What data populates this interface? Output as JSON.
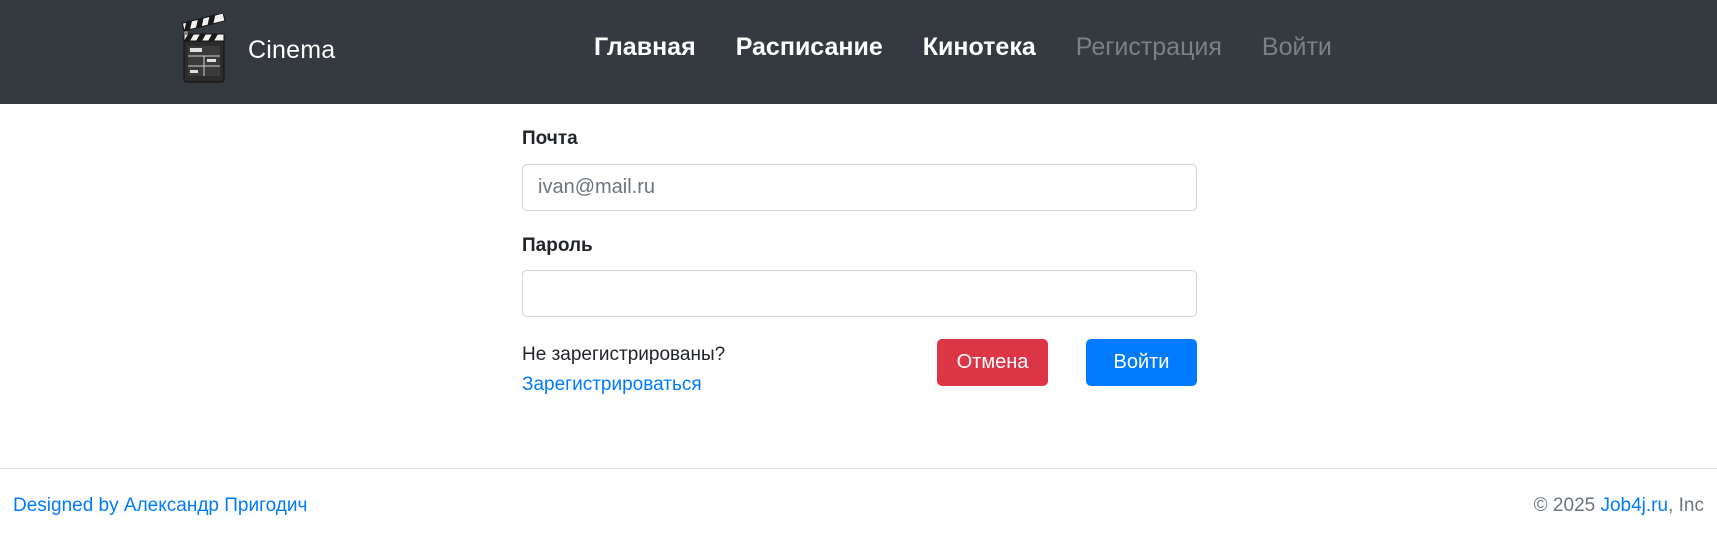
{
  "navbar": {
    "brand": {
      "logo_icon": "clapperboard-icon",
      "name": "Cinema"
    },
    "links": [
      {
        "label": "Главная",
        "state": "active"
      },
      {
        "label": "Расписание",
        "state": "active"
      },
      {
        "label": "Кинотека",
        "state": "active"
      },
      {
        "label": "Регистрация",
        "state": "muted"
      },
      {
        "label": "Войти",
        "state": "muted"
      }
    ]
  },
  "login_form": {
    "email_label": "Почта",
    "email_placeholder": "ivan@mail.ru",
    "email_value": "",
    "password_label": "Пароль",
    "password_value": "",
    "not_registered_text": "Не зарегистрированы?",
    "register_link": "Зарегистрироваться",
    "cancel_button": "Отмена",
    "login_button": "Войти"
  },
  "footer": {
    "designed_by": "Designed by Александр Пригодич",
    "copyright_prefix": "© 2025",
    "company_link": "Job4j.ru",
    "copyright_suffix": ", Inc"
  },
  "colors": {
    "navbar_bg": "#343a40",
    "primary": "#007bff",
    "danger": "#dc3545",
    "muted_link": "#7a8086"
  }
}
